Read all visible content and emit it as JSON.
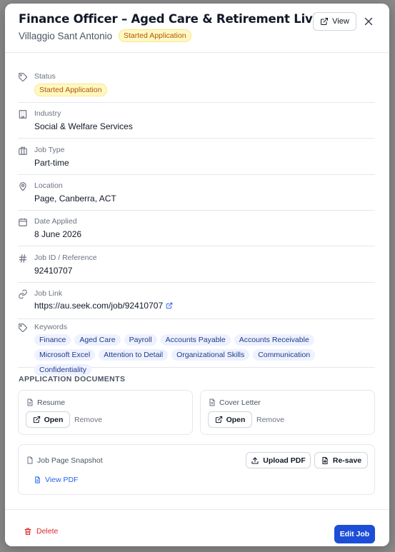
{
  "header": {
    "title": "Finance Officer – Aged Care & Retirement Living",
    "company": "Villaggio Sant Antonio",
    "status_badge": "Started Application",
    "view_label": "View"
  },
  "fields": {
    "status": {
      "label": "Status",
      "value": "Started Application"
    },
    "industry": {
      "label": "Industry",
      "value": "Social & Welfare Services"
    },
    "job_type": {
      "label": "Job Type",
      "value": "Part-time"
    },
    "location": {
      "label": "Location",
      "value": "Page, Canberra, ACT"
    },
    "date_applied": {
      "label": "Date Applied",
      "value": "8 June 2026"
    },
    "job_id": {
      "label": "Job ID / Reference",
      "value": "92410707"
    },
    "job_link": {
      "label": "Job Link",
      "value": "https://au.seek.com/job/92410707"
    },
    "keywords": {
      "label": "Keywords",
      "items": [
        "Finance",
        "Aged Care",
        "Payroll",
        "Accounts Payable",
        "Accounts Receivable",
        "Microsoft Excel",
        "Attention to Detail",
        "Organizational Skills",
        "Communication",
        "Confidentiality"
      ]
    }
  },
  "documents": {
    "section_title": "APPLICATION DOCUMENTS",
    "resume": {
      "title": "Resume",
      "open_label": "Open",
      "remove_label": "Remove"
    },
    "cover_letter": {
      "title": "Cover Letter",
      "open_label": "Open",
      "remove_label": "Remove"
    },
    "snapshot": {
      "title": "Job Page Snapshot",
      "upload_label": "Upload PDF",
      "resave_label": "Re-save",
      "view_pdf_label": "View PDF"
    }
  },
  "footer": {
    "delete_label": "Delete",
    "edit_label": "Edit Job"
  },
  "colors": {
    "accent": "#1d4ed8",
    "danger": "#dc2626",
    "badge_bg": "#fef9c3",
    "badge_text": "#b45309",
    "chip_bg": "#eef2ff"
  }
}
